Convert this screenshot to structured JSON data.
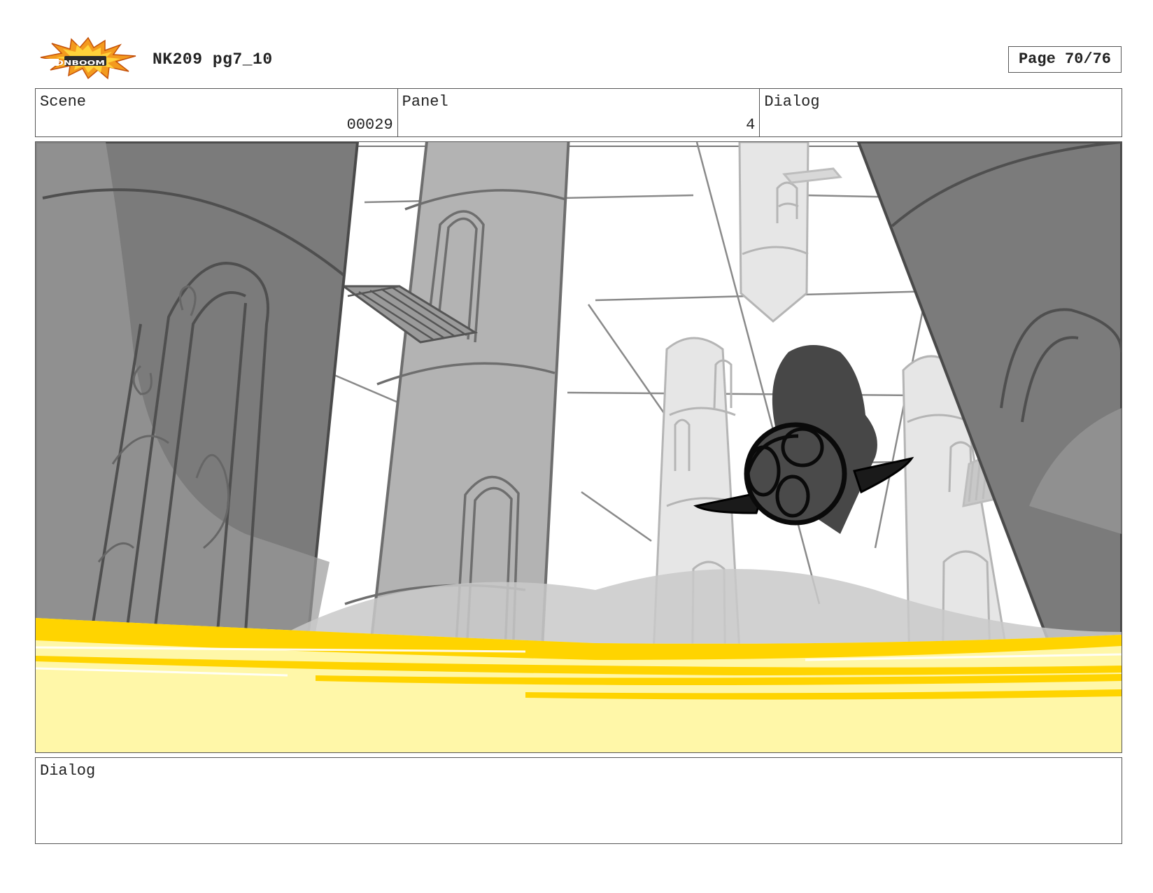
{
  "header": {
    "logo_text": "TOONBOOM",
    "title": "NK209 pg7_10",
    "page_label": "Page 70/76"
  },
  "info_row": {
    "scene_label": "Scene",
    "scene_value": "00029",
    "panel_label": "Panel",
    "panel_value": "4",
    "dialog_label": "Dialog"
  },
  "panel_image": {
    "description_icon": "storyboard-sketch-image"
  },
  "dialog_section": {
    "label": "Dialog"
  },
  "colors": {
    "border": "#555555",
    "sky": "#ffffff",
    "pillar_dark": "#808080",
    "pillar_mid": "#aaaaaa",
    "pillar_light": "#e3e3e3",
    "water_yellow": "#ffd400",
    "water_pale": "#fff7a8",
    "logo_orange": "#f39a1e"
  }
}
